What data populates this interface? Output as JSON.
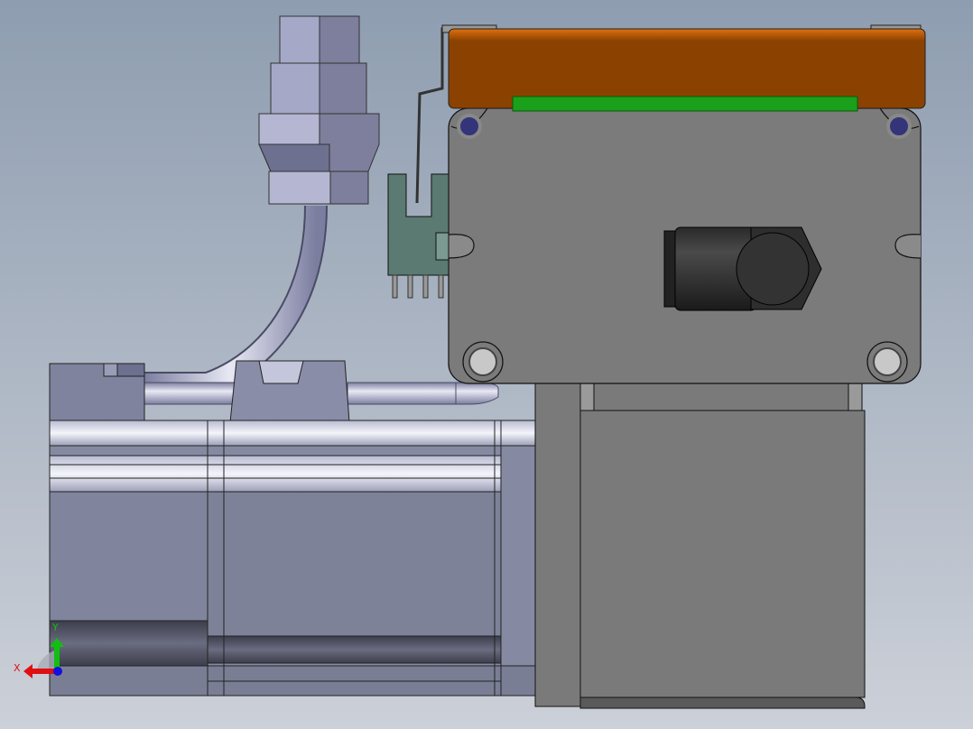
{
  "viewport": {
    "background_top": "#8e9db0",
    "background_bottom": "#ccd0d8"
  },
  "colors": {
    "motor_body": "#8a8ea4",
    "motor_highlight": "#d8dbe8",
    "gearbox": "#7a7a7a",
    "cover_orange": "#8b4200",
    "pcb_green": "#1aa01a",
    "connector_teal": "#5a7a72",
    "connector_lavender": "#9a9cbc"
  },
  "triad": {
    "x_label": "X",
    "y_label": "Y",
    "x_color": "#e01010",
    "y_color": "#10c010",
    "z_color": "#1010e0"
  }
}
